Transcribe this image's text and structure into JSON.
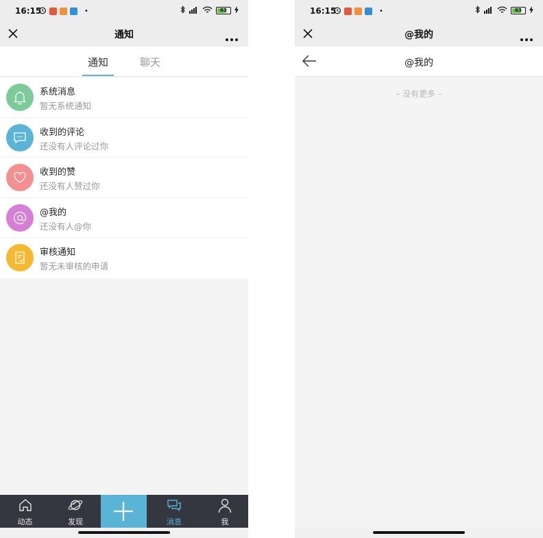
{
  "status": {
    "time": "16:15",
    "battery": "63",
    "dot": "•"
  },
  "left": {
    "title": "通知",
    "tabs": [
      {
        "label": "通知",
        "active": true
      },
      {
        "label": "聊天",
        "active": false
      }
    ],
    "items": [
      {
        "title": "系统消息",
        "subtitle": "暂无系统通知",
        "icon": "bell-icon",
        "color": "#7ccc99"
      },
      {
        "title": "收到的评论",
        "subtitle": "还没有人评论过你",
        "icon": "comment-icon",
        "color": "#5ab4d6"
      },
      {
        "title": "收到的赞",
        "subtitle": "还没有人赞过你",
        "icon": "heart-icon",
        "color": "#f58e8e"
      },
      {
        "title": "@我的",
        "subtitle": "还没有人@你",
        "icon": "at-icon",
        "color": "#d77fd7"
      },
      {
        "title": "审核通知",
        "subtitle": "暂无未审核的申请",
        "icon": "review-icon",
        "color": "#f5b82e"
      }
    ],
    "nav": [
      {
        "label": "动态",
        "icon": "home-icon"
      },
      {
        "label": "发现",
        "icon": "planet-icon"
      },
      {
        "label": "",
        "icon": "plus-icon"
      },
      {
        "label": "消息",
        "icon": "chat-icon",
        "active": true
      },
      {
        "label": "我",
        "icon": "user-icon"
      }
    ]
  },
  "right": {
    "title": "@我的",
    "subtitle": "@我的",
    "empty_text": "– 没有更多 –"
  },
  "colors": {
    "accent": "#5ab4d6",
    "nav_bg": "#34373f"
  }
}
